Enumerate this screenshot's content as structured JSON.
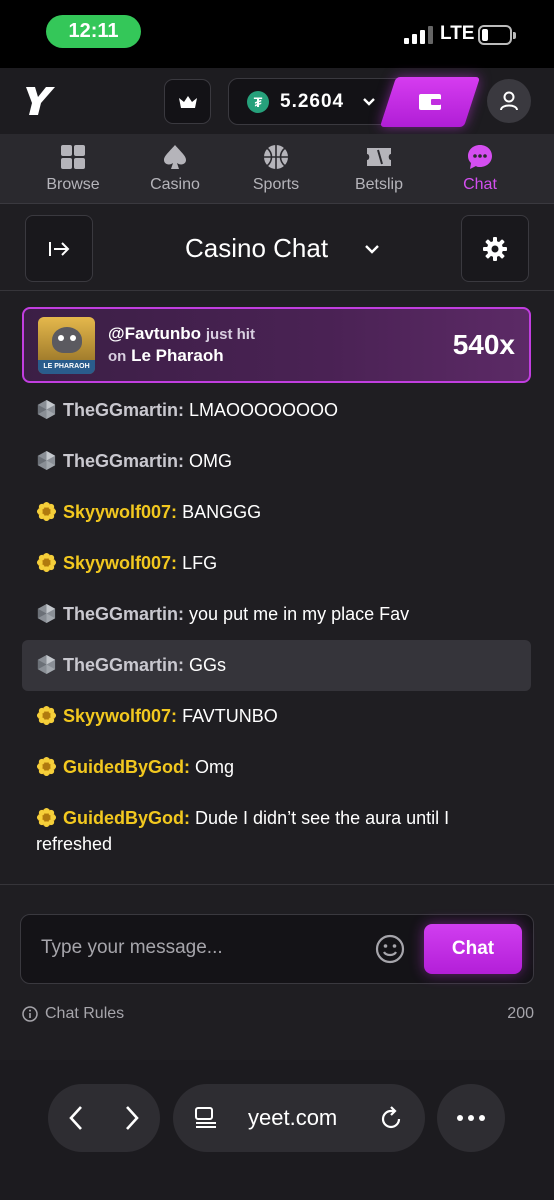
{
  "status_bar": {
    "time": "12:11",
    "network": "LTE"
  },
  "header": {
    "balance": "5.2604",
    "currency_symbol": "₮"
  },
  "nav": {
    "tabs": [
      {
        "label": "Browse",
        "icon": "grid-icon"
      },
      {
        "label": "Casino",
        "icon": "spade-icon"
      },
      {
        "label": "Sports",
        "icon": "basketball-icon"
      },
      {
        "label": "Betslip",
        "icon": "ticket-icon"
      },
      {
        "label": "Chat",
        "icon": "chat-bubble-icon",
        "active": true
      }
    ]
  },
  "chat": {
    "title": "Casino Chat",
    "win": {
      "user": "@Favtunbo",
      "verb": "just hit",
      "on": "on",
      "game": "Le Pharaoh",
      "thumb_caption": "LE PHARAOH",
      "multiplier": "540x"
    },
    "messages": [
      {
        "user": "TheGGmartin:",
        "text": "LMAOOOOOOOO",
        "tier": "silver"
      },
      {
        "user": "TheGGmartin:",
        "text": "OMG",
        "tier": "silver"
      },
      {
        "user": "Skyywolf007:",
        "text": "BANGGG",
        "tier": "gold"
      },
      {
        "user": "Skyywolf007:",
        "text": "LFG",
        "tier": "gold"
      },
      {
        "user": "TheGGmartin:",
        "text": "you put me in my place Fav",
        "tier": "silver"
      },
      {
        "user": "TheGGmartin:",
        "text": "GGs",
        "tier": "silver",
        "highlight": true
      },
      {
        "user": "Skyywolf007:",
        "text": "FAVTUNBO",
        "tier": "gold"
      },
      {
        "user": "GuidedByGod:",
        "text": "Omg",
        "tier": "gold"
      },
      {
        "user": "GuidedByGod:",
        "text": "Dude I didn’t see the aura until I refreshed",
        "tier": "gold"
      }
    ],
    "input_placeholder": "Type your message...",
    "send_label": "Chat",
    "rules_label": "Chat Rules",
    "char_count": "200"
  },
  "browser": {
    "url": "yeet.com"
  },
  "colors": {
    "accent": "#c93ae8",
    "gold": "#f2c81f",
    "silver": "#c9c8cf"
  }
}
